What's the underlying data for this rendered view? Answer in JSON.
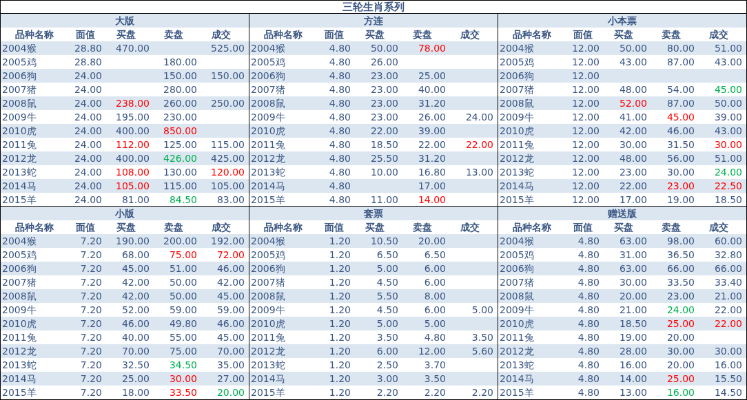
{
  "title": "三轮生肖系列",
  "panels": [
    {
      "title": "大版",
      "columns": [
        "品种名称",
        "面值",
        "买盘",
        "卖盘",
        "成交"
      ],
      "rows": [
        [
          "2004猴",
          "28.80",
          "470.00",
          null,
          "525.00"
        ],
        [
          "2005鸡",
          "28.80",
          null,
          "180.00",
          null
        ],
        [
          "2006狗",
          "24.00",
          null,
          "150.00",
          "150.00"
        ],
        [
          "2007猪",
          "24.00",
          null,
          "280.00",
          null
        ],
        [
          "2008鼠",
          "24.00",
          {
            "text": "238.00",
            "color": "#ff0000"
          },
          "260.00",
          "250.00"
        ],
        [
          "2009牛",
          "24.00",
          "195.00",
          "230.00",
          null
        ],
        [
          "2010虎",
          "24.00",
          "400.00",
          {
            "text": "850.00",
            "color": "#ff0000"
          },
          null
        ],
        [
          "2011兔",
          "24.00",
          {
            "text": "112.00",
            "color": "#ff0000"
          },
          "125.00",
          "115.00"
        ],
        [
          "2012龙",
          "24.00",
          "400.00",
          {
            "text": "426.00",
            "color": "#00b050"
          },
          "425.00"
        ],
        [
          "2013蛇",
          "24.00",
          {
            "text": "108.00",
            "color": "#ff0000"
          },
          "130.00",
          {
            "text": "120.00",
            "color": "#ff0000"
          }
        ],
        [
          "2014马",
          "24.00",
          {
            "text": "105.00",
            "color": "#ff0000"
          },
          "115.00",
          "105.00"
        ],
        [
          "2015羊",
          "24.00",
          "81.00",
          {
            "text": "84.50",
            "color": "#00b050"
          },
          "83.00"
        ]
      ]
    },
    {
      "title": "方连",
      "columns": [
        "品种名称",
        "面值",
        "买盘",
        "卖盘",
        "成交"
      ],
      "rows": [
        [
          "2004猴",
          "4.80",
          "50.00",
          {
            "text": "78.00",
            "color": "#ff0000"
          },
          null
        ],
        [
          "2005鸡",
          "4.80",
          "26.00",
          null,
          null
        ],
        [
          "2006狗",
          "4.80",
          "23.00",
          "25.00",
          null
        ],
        [
          "2007猪",
          "4.80",
          "23.00",
          "40.00",
          null
        ],
        [
          "2008鼠",
          "4.80",
          "23.00",
          "31.20",
          null
        ],
        [
          "2009牛",
          "4.80",
          "23.00",
          "26.00",
          "24.00"
        ],
        [
          "2010虎",
          "4.80",
          "22.00",
          "39.00",
          null
        ],
        [
          "2011兔",
          "4.80",
          "18.50",
          "22.00",
          {
            "text": "22.00",
            "color": "#ff0000"
          }
        ],
        [
          "2012龙",
          "4.80",
          "25.50",
          "31.20",
          null
        ],
        [
          "2013蛇",
          "4.80",
          "10.00",
          "16.80",
          "13.00"
        ],
        [
          "2014马",
          "4.80",
          null,
          "17.00",
          null
        ],
        [
          "2015羊",
          "4.80",
          "11.00",
          {
            "text": "14.00",
            "color": "#ff0000"
          },
          null
        ]
      ]
    },
    {
      "title": "小本票",
      "columns": [
        "品种名称",
        "面值",
        "买盘",
        "卖盘",
        "成交"
      ],
      "rows": [
        [
          "2004猴",
          "12.00",
          "50.00",
          "80.00",
          "51.00"
        ],
        [
          "2005鸡",
          "12.00",
          "43.00",
          "87.00",
          "43.00"
        ],
        [
          "2006狗",
          "12.00",
          null,
          null,
          null
        ],
        [
          "2007猪",
          "12.00",
          "48.00",
          "54.00",
          {
            "text": "45.00",
            "color": "#00b050"
          }
        ],
        [
          "2008鼠",
          "12.00",
          {
            "text": "52.00",
            "color": "#ff0000"
          },
          "87.00",
          "50.00"
        ],
        [
          "2009牛",
          "12.00",
          "41.00",
          {
            "text": "45.00",
            "color": "#ff0000"
          },
          "39.00"
        ],
        [
          "2010虎",
          "12.00",
          "42.00",
          "46.00",
          "43.00"
        ],
        [
          "2011兔",
          "12.00",
          "30.00",
          "31.50",
          {
            "text": "30.00",
            "color": "#ff0000"
          }
        ],
        [
          "2012龙",
          "12.00",
          "48.00",
          "56.00",
          "51.00"
        ],
        [
          "2013蛇",
          "12.00",
          "23.00",
          "30.00",
          {
            "text": "24.00",
            "color": "#00b050"
          }
        ],
        [
          "2014马",
          "12.00",
          "22.00",
          {
            "text": "23.00",
            "color": "#ff0000"
          },
          {
            "text": "22.50",
            "color": "#ff0000"
          }
        ],
        [
          "2015羊",
          "12.00",
          "17.00",
          "19.00",
          "18.50"
        ]
      ]
    },
    {
      "title": "小版",
      "columns": [
        "品种名称",
        "面值",
        "买盘",
        "卖盘",
        "成交"
      ],
      "rows": [
        [
          "2004猴",
          "7.20",
          "190.00",
          "200.00",
          "192.00"
        ],
        [
          "2005鸡",
          "7.20",
          "68.00",
          {
            "text": "75.00",
            "color": "#ff0000"
          },
          {
            "text": "72.00",
            "color": "#ff0000"
          }
        ],
        [
          "2006狗",
          "7.20",
          "45.00",
          "51.00",
          "46.00"
        ],
        [
          "2007猪",
          "7.20",
          "42.00",
          "50.00",
          "42.00"
        ],
        [
          "2008鼠",
          "7.20",
          "42.00",
          "50.00",
          "45.00"
        ],
        [
          "2009牛",
          "7.20",
          "52.00",
          "59.00",
          "59.00"
        ],
        [
          "2010虎",
          "7.20",
          "46.00",
          "49.80",
          "46.00"
        ],
        [
          "2011兔",
          "7.20",
          "40.00",
          "55.00",
          "45.00"
        ],
        [
          "2012龙",
          "7.20",
          "70.00",
          "75.00",
          "70.00"
        ],
        [
          "2013蛇",
          "7.20",
          "32.50",
          {
            "text": "34.50",
            "color": "#00b050"
          },
          "35.00"
        ],
        [
          "2014马",
          "7.20",
          "25.00",
          {
            "text": "30.00",
            "color": "#ff0000"
          },
          "27.00"
        ],
        [
          "2015羊",
          "7.20",
          "18.00",
          {
            "text": "33.50",
            "color": "#ff0000"
          },
          {
            "text": "20.00",
            "color": "#00b050"
          }
        ]
      ]
    },
    {
      "title": "套票",
      "columns": [
        "品种名称",
        "面值",
        "买盘",
        "卖盘",
        "成交"
      ],
      "rows": [
        [
          "2004猴",
          "1.20",
          "10.50",
          "20.00",
          null
        ],
        [
          "2005鸡",
          "1.20",
          "6.50",
          "6.50",
          null
        ],
        [
          "2006狗",
          "1.20",
          "5.00",
          "6.00",
          null
        ],
        [
          "2007猪",
          "1.20",
          "4.50",
          "6.00",
          null
        ],
        [
          "2008鼠",
          "1.20",
          "5.50",
          "8.00",
          null
        ],
        [
          "2009牛",
          "1.20",
          "4.50",
          "6.00",
          "5.00"
        ],
        [
          "2010虎",
          "1.20",
          "5.00",
          "5.00",
          null
        ],
        [
          "2011兔",
          "1.20",
          "3.50",
          "4.80",
          "3.50"
        ],
        [
          "2012龙",
          "1.20",
          "6.00",
          "12.00",
          "5.60"
        ],
        [
          "2013蛇",
          "1.20",
          "2.50",
          "3.70",
          null
        ],
        [
          "2014马",
          "1.20",
          "3.00",
          "3.50",
          null
        ],
        [
          "2015羊",
          "1.20",
          "2.20",
          "2.20",
          "2.20"
        ]
      ]
    },
    {
      "title": "赠送版",
      "columns": [
        "品种名称",
        "面值",
        "买盘",
        "卖盘",
        "成交"
      ],
      "rows": [
        [
          "2004猴",
          "4.80",
          "63.00",
          "98.00",
          "60.00"
        ],
        [
          "2005鸡",
          "4.80",
          "31.00",
          "36.50",
          "32.80"
        ],
        [
          "2006狗",
          "4.80",
          "63.00",
          "66.00",
          "66.00"
        ],
        [
          "2007猪",
          "4.80",
          "30.00",
          "33.50",
          "33.40"
        ],
        [
          "2008鼠",
          "4.80",
          "20.00",
          "23.00",
          "21.00"
        ],
        [
          "2009牛",
          "4.80",
          "21.00",
          {
            "text": "24.00",
            "color": "#00b050"
          },
          "22.00"
        ],
        [
          "2010虎",
          "4.80",
          "18.50",
          {
            "text": "25.00",
            "color": "#ff0000"
          },
          {
            "text": "22.00",
            "color": "#ff0000"
          }
        ],
        [
          "2011兔",
          "4.80",
          "19.00",
          "20.00",
          null
        ],
        [
          "2012龙",
          "4.80",
          "28.00",
          "30.00",
          "30.00"
        ],
        [
          "2013蛇",
          "4.80",
          "16.00",
          "20.00",
          "16.00"
        ],
        [
          "2014马",
          "4.80",
          "14.00",
          {
            "text": "25.00",
            "color": "#ff0000"
          },
          "15.50"
        ],
        [
          "2015羊",
          "4.80",
          "13.00",
          {
            "text": "16.00",
            "color": "#00b050"
          },
          "14.50"
        ]
      ]
    }
  ]
}
